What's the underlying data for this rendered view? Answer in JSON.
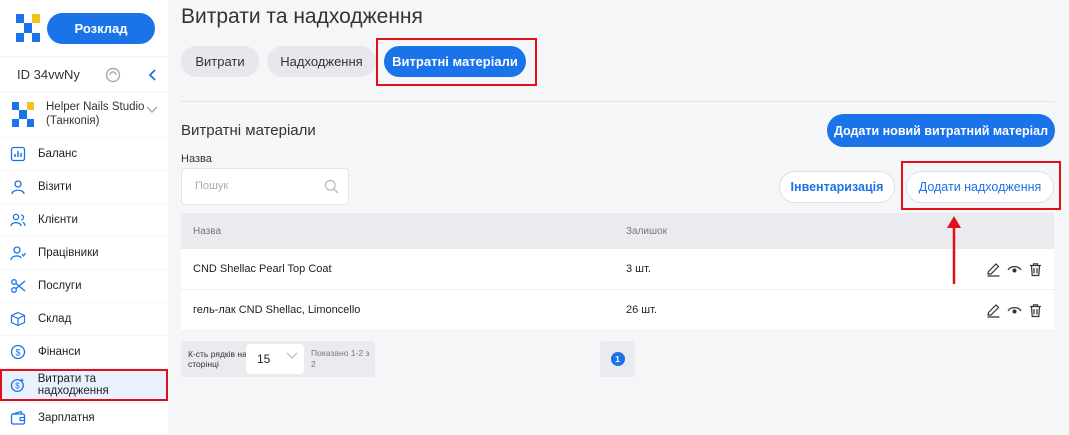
{
  "sidebar": {
    "schedule_button": "Розклад",
    "id_text": "ID 34vwNy",
    "studio_name": "Helper Nails Studio (Танкопія)",
    "items": [
      {
        "label": "Баланс",
        "icon": "chart-icon"
      },
      {
        "label": "Візити",
        "icon": "person-icon"
      },
      {
        "label": "Клієнти",
        "icon": "people-icon"
      },
      {
        "label": "Працівники",
        "icon": "staff-icon"
      },
      {
        "label": "Послуги",
        "icon": "scissors-icon"
      },
      {
        "label": "Склад",
        "icon": "box-icon"
      },
      {
        "label": "Фінанси",
        "icon": "dollar-icon"
      },
      {
        "label": "Витрати та надходження",
        "icon": "coin-icon",
        "active": true
      },
      {
        "label": "Зарплатня",
        "icon": "wallet-icon"
      }
    ]
  },
  "main": {
    "title": "Витрати та надходження",
    "tabs": [
      {
        "label": "Витрати"
      },
      {
        "label": "Надходження"
      },
      {
        "label": "Витратні матеріали",
        "active": true
      }
    ],
    "section_title": "Витратні матеріали",
    "add_material_button": "Додати новий витратний матеріал",
    "name_label": "Назва",
    "search_placeholder": "Пошук",
    "inventory_button": "Інвентаризація",
    "add_income_button": "Додати надходження",
    "table": {
      "headers": [
        "Назва",
        "Залишок"
      ],
      "rows": [
        {
          "name": "CND Shellac Pearl Top Coat",
          "remaining": "3 шт."
        },
        {
          "name": "гель-лак CND Shellac, Limoncello",
          "remaining": "26 шт."
        }
      ]
    },
    "pagination": {
      "rows_label": "К-сть рядків на сторінці",
      "rows_value": "15",
      "shown": "Показано 1-2 з 2",
      "current_page": "1"
    }
  },
  "colors": {
    "accent": "#1a73e8",
    "highlight": "#e0101a"
  }
}
